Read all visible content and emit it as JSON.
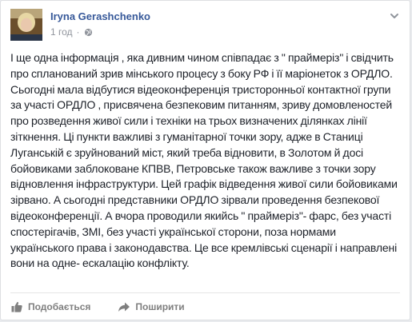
{
  "post": {
    "author": "Iryna Gerashchenko",
    "time": "1 год",
    "meta_separator": "·",
    "paragraph": "І ще одна інформація , яка дивним чином співпадає з \" праймеріз\" і свідчить про спланований зрив мінського процесу з боку РФ і її маріонеток з ОРДЛО. Сьогодні мала відбутися відеоконференція тристоронньої контактної групи за участі ОРДЛО , присвячена безпековим питанням, зриву домовленостей про розведення живої сили і техніки на трьох визначених ділянках лінії зіткнення. Ці пункти важливі з гуманітарної точки зору, адже в Станиці Луганській є зруйнований міст, який треба відновити, в Золотом й досі бойовиками заблоковане КПВВ, Петровське також важливе з точки зору відновлення інфраструктури. Цей графік відведення живої сили бойовиками зірвано. А сьогодні представники ОРДЛО зірвали проведення безпекової відеоконференції. А вчора проводили якийсь \" праймеріз\"- фарс, без участі спостерігачів, ЗМІ, без участі української сторони, поза нормами українського права і законодавства. Це все кремлівські сценарії і направлені вони на одне- ескалацію конфлікту."
  },
  "actions": {
    "like_label": "Подобається",
    "share_label": "Поширити"
  },
  "icons": {
    "globe": "globe-icon",
    "chevron": "chevron-down-icon",
    "like": "thumbs-up-icon",
    "share": "share-arrow-icon"
  },
  "colors": {
    "author_link": "#365899",
    "meta_gray": "#90949c",
    "text": "#1d2129",
    "action_gray": "#7f7f7f"
  }
}
